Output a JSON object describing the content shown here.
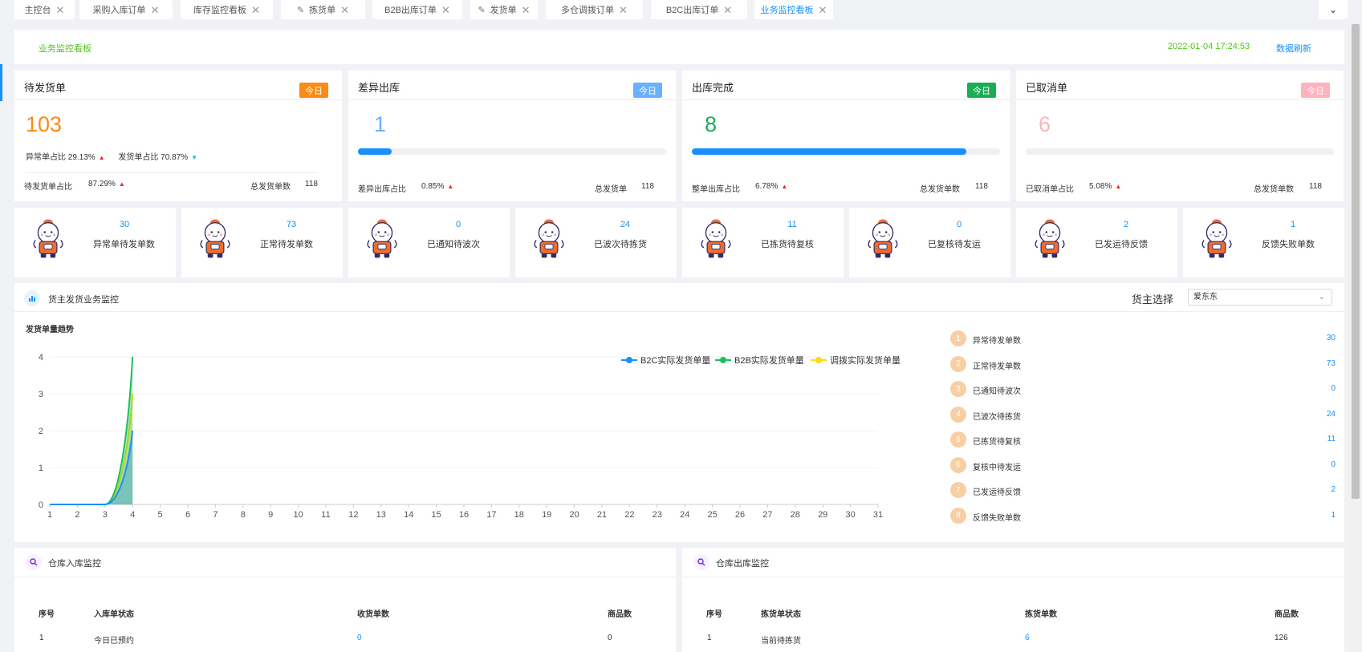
{
  "tabs": [
    {
      "label": "主控台",
      "closable": true,
      "active": false,
      "icon": ""
    },
    {
      "label": "采购入库订单",
      "closable": true,
      "active": false,
      "icon": ""
    },
    {
      "label": "库存监控看板",
      "closable": true,
      "active": false,
      "icon": ""
    },
    {
      "label": "拣货单",
      "closable": true,
      "active": false,
      "icon": "pen-icon"
    },
    {
      "label": "B2B出库订单",
      "closable": true,
      "active": false,
      "icon": ""
    },
    {
      "label": "发货单",
      "closable": true,
      "active": false,
      "icon": "pen-icon"
    },
    {
      "label": "多仓调拨订单",
      "closable": true,
      "active": false,
      "icon": ""
    },
    {
      "label": "B2C出库订单",
      "closable": true,
      "active": false,
      "icon": ""
    },
    {
      "label": "业务监控看板",
      "closable": true,
      "active": true,
      "icon": ""
    }
  ],
  "close_glyph": "✕",
  "dropdown_glyph": "⌄",
  "header": {
    "title": "业务监控看板",
    "datetime": "2022-01-04 17:24:53",
    "refresh_label": "数据刷新"
  },
  "kpis": [
    {
      "title": "待发货单",
      "badge": "今日",
      "badge_color": "#fa8c16",
      "value": "103",
      "value_color": "#fa8c16",
      "abnormal_ratio_label": "异常单占比 29.13%",
      "ship_ratio_label": "发货单占比 70.87%",
      "foot_label": "待发货单占比",
      "foot_pct": "87.29%",
      "total_label": "总发货单数",
      "total": "118"
    },
    {
      "title": "差异出库",
      "badge": "今日",
      "badge_color": "#69b1ff",
      "value": "1",
      "value_color": "#69b1ff",
      "progress": 0.11,
      "foot_label": "差异出库占比",
      "foot_pct": "0.85%",
      "total_label": "总发货单",
      "total": "118"
    },
    {
      "title": "出库完成",
      "badge": "今日",
      "badge_color": "#1aad55",
      "value": "8",
      "value_color": "#1aad55",
      "progress": 0.89,
      "foot_label": "整单出库占比",
      "foot_pct": "6.78%",
      "total_label": "总发货单数",
      "total": "118"
    },
    {
      "title": "已取消单",
      "badge": "今日",
      "badge_color": "#ffb3bd",
      "value": "6",
      "value_color": "#ffb3bd",
      "progress": 0,
      "foot_label": "已取消单占比",
      "foot_pct": "5.08%",
      "total_label": "总发货单数",
      "total": "118"
    }
  ],
  "up_glyph": "▲",
  "down_glyph": "▼",
  "mini_cards": [
    {
      "value": "30",
      "label": "异常单待发单数"
    },
    {
      "value": "73",
      "label": "正常待发单数"
    },
    {
      "value": "0",
      "label": "已通知待波次"
    },
    {
      "value": "24",
      "label": "已波次待拣货"
    },
    {
      "value": "11",
      "label": "已拣货待复核"
    },
    {
      "value": "0",
      "label": "已复核待发运"
    },
    {
      "value": "2",
      "label": "已发运待反馈"
    },
    {
      "value": "1",
      "label": "反馈失败单数"
    }
  ],
  "monitor": {
    "title": "货主发货业务监控",
    "owner_label": "货主选择",
    "owner_value": "爱东东",
    "chart_heading": "发货单量趋势"
  },
  "chart_data": {
    "type": "area",
    "x": [
      1,
      2,
      3,
      4,
      5,
      6,
      7,
      8,
      9,
      10,
      11,
      12,
      13,
      14,
      15,
      16,
      17,
      18,
      19,
      20,
      21,
      22,
      23,
      24,
      25,
      26,
      27,
      28,
      29,
      30,
      31
    ],
    "ylim": [
      0,
      4
    ],
    "yticks": [
      0,
      1,
      2,
      3,
      4
    ],
    "legend_position": "top-right",
    "series": [
      {
        "name": "B2C实际发货单量",
        "color": "#1890ff",
        "values": [
          0,
          0,
          0,
          2
        ]
      },
      {
        "name": "B2B实际发货单量",
        "color": "#19c15e",
        "values": [
          0,
          0,
          0,
          4
        ]
      },
      {
        "name": "调拨实际发货单量",
        "color": "#fadb14",
        "values": [
          0,
          0,
          0,
          3
        ]
      }
    ]
  },
  "ranking": [
    {
      "rank": "1",
      "label": "异常待发单数",
      "value": "30"
    },
    {
      "rank": "2",
      "label": "正常待发单数",
      "value": "73"
    },
    {
      "rank": "3",
      "label": "已通知待波次",
      "value": "0"
    },
    {
      "rank": "4",
      "label": "已波次待拣货",
      "value": "24"
    },
    {
      "rank": "5",
      "label": "已拣货待复核",
      "value": "11"
    },
    {
      "rank": "6",
      "label": "复核中待发运",
      "value": "0"
    },
    {
      "rank": "7",
      "label": "已发运待反馈",
      "value": "2"
    },
    {
      "rank": "8",
      "label": "反馈失败单数",
      "value": "1"
    }
  ],
  "inbound": {
    "title": "仓库入库监控",
    "columns": [
      "序号",
      "入库单状态",
      "收货单数",
      "商品数"
    ],
    "rows": [
      [
        "1",
        "今日已预约",
        "0",
        "0"
      ]
    ]
  },
  "outbound": {
    "title": "仓库出库监控",
    "columns": [
      "序号",
      "拣货单状态",
      "拣货单数",
      "商品数"
    ],
    "rows": [
      [
        "1",
        "当前待拣货",
        "6",
        "126"
      ]
    ]
  }
}
